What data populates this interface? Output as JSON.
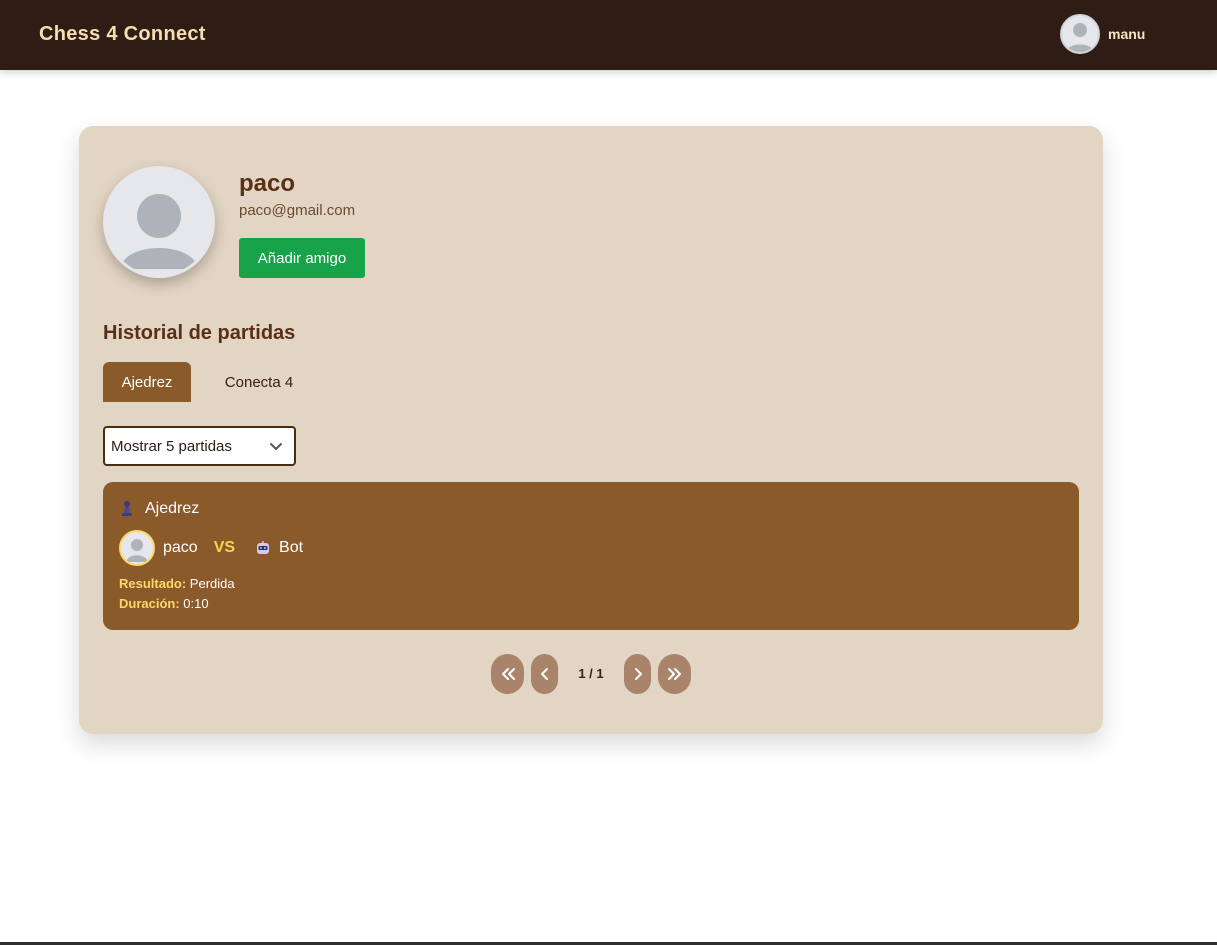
{
  "navbar": {
    "brand": "Chess 4 Connect",
    "user": {
      "username": "manu",
      "avatar_icon": "user-avatar-icon"
    }
  },
  "profile": {
    "name": "paco",
    "email": "paco@gmail.com",
    "add_friend_label": "Añadir amigo",
    "avatar_icon": "user-avatar-icon"
  },
  "history": {
    "title": "Historial de partidas",
    "tabs": [
      {
        "label": "Ajedrez",
        "active": true
      },
      {
        "label": "Conecta 4",
        "active": false
      }
    ],
    "page_size_select": {
      "selected": "Mostrar 5 partidas"
    },
    "games": [
      {
        "type": "Ajedrez",
        "type_icon": "chess-pawn-icon",
        "player1": "paco",
        "vs": "VS",
        "player2": "Bot",
        "player2_icon": "robot-icon",
        "result_label": "Resultado:",
        "result": "Perdida",
        "duration_label": "Duración:",
        "duration": "0:10"
      }
    ],
    "pagination": {
      "info": "1 / 1"
    }
  },
  "colors": {
    "navbar_bg": "#2f1c15",
    "brand": "#f5deb0",
    "card_bg": "#e3d5c3",
    "accent_brown": "#8b5a2b",
    "success_green": "#16a34a",
    "highlight_yellow": "#fcd34d"
  }
}
